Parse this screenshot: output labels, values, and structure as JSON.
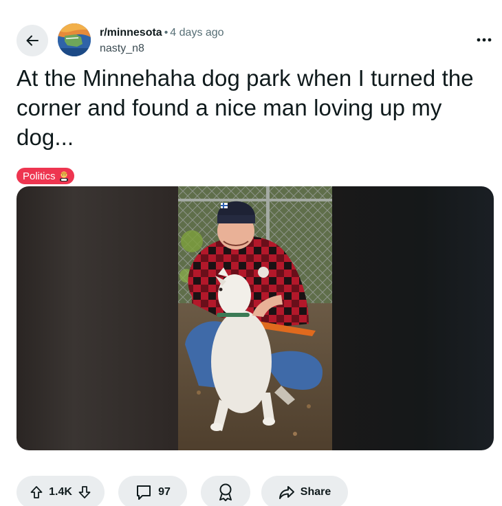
{
  "post": {
    "subreddit": "r/minnesota",
    "separator": "•",
    "time_ago": "4 days ago",
    "author": "nasty_n8",
    "title": "At the Minnehaha dog park when I turned the corner and found a nice man loving up my dog...",
    "flair": {
      "label": "Politics",
      "color": "#ee3550"
    },
    "image_alt": "Man in a red buffalo-plaid jacket and navy beanie crouching to hug a white dog at a dog park"
  },
  "actions": {
    "upvote_icon": "arrow-up-icon",
    "score": "1.4K",
    "downvote_icon": "arrow-down-icon",
    "comment_icon": "comment-icon",
    "comments": "97",
    "award_icon": "award-icon",
    "share_icon": "share-icon",
    "share_label": "Share"
  },
  "header": {
    "back_icon": "arrow-left-icon",
    "more_icon": "ellipsis-icon"
  },
  "colors": {
    "pill_bg": "#eaedef",
    "meta_text": "#576f76",
    "title_text": "#0f1a1c"
  }
}
